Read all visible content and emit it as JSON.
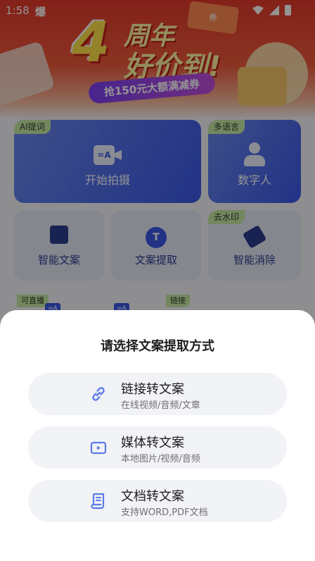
{
  "status_bar": {
    "time": "1:58",
    "sim": "爆"
  },
  "banner": {
    "number": "4",
    "line1": "周年",
    "line2": "好价到!",
    "coupon": "券",
    "subtitle": "抢150元大额满减券"
  },
  "features": {
    "shoot": {
      "tag": "AI提词",
      "label": "开始拍摄",
      "icon_text": "=A"
    },
    "avatar": {
      "tag": "多语言",
      "label": "数字人"
    },
    "copywriting": {
      "label": "智能文案"
    },
    "extract": {
      "label": "文案提取",
      "icon_text": "T"
    },
    "erase": {
      "tag": "去水印",
      "label": "智能消除"
    }
  },
  "row3": {
    "tag_a": "可直播",
    "tag_b": "链接",
    "mini_a": "=A",
    "mini_b": "=A"
  },
  "sheet": {
    "title": "请选择文案提取方式",
    "options": [
      {
        "title": "链接转文案",
        "subtitle": "在线视频/音频/文章",
        "icon": "link-icon"
      },
      {
        "title": "媒体转文案",
        "subtitle": "本地图片/视频/音频",
        "icon": "media-icon"
      },
      {
        "title": "文档转文案",
        "subtitle": "支持WORD,PDF文档",
        "icon": "document-icon"
      }
    ]
  },
  "colors": {
    "accent": "#5b7be8",
    "sheet_bg": "#ffffff",
    "option_bg": "#f2f3f7",
    "tag_green": "#c6e8a4",
    "card_blue": "#3c57e6"
  }
}
